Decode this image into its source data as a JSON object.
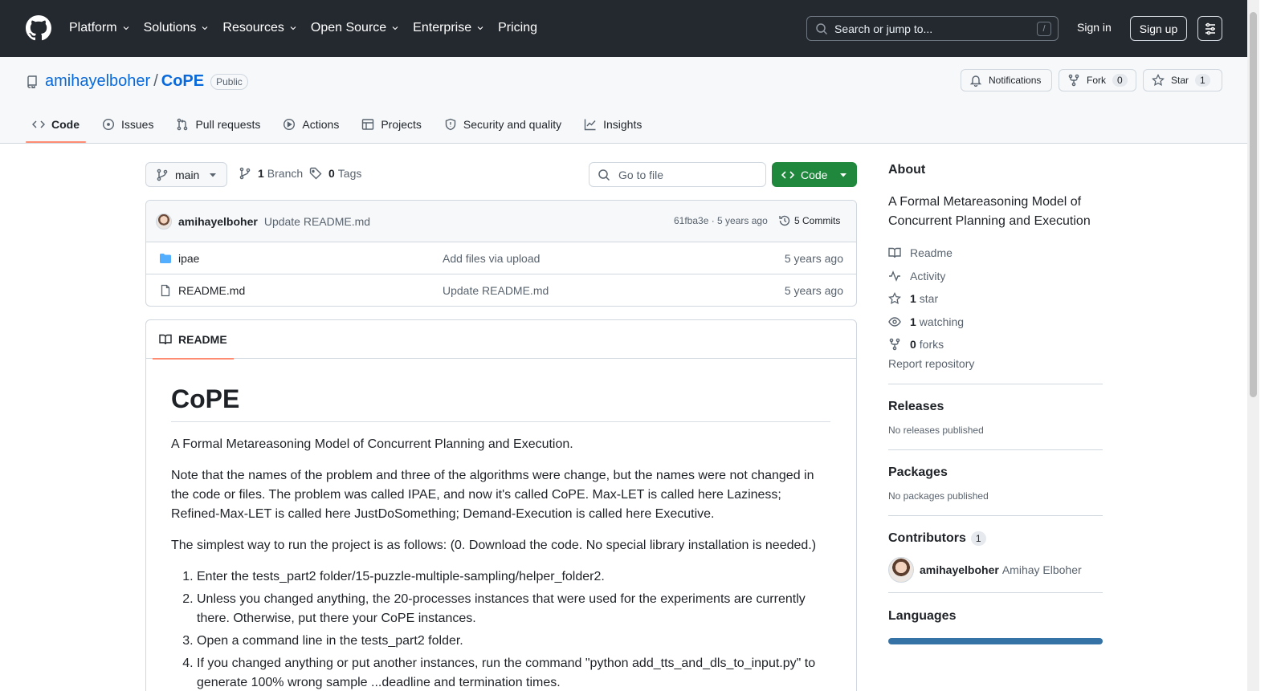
{
  "topbar": {
    "nav": [
      "Platform",
      "Solutions",
      "Resources",
      "Open Source",
      "Enterprise",
      "Pricing"
    ],
    "search_placeholder": "Search or jump to...",
    "search_shortcut": "/",
    "signin": "Sign in",
    "signup": "Sign up"
  },
  "repo": {
    "owner": "amihayelboher",
    "separator": "/",
    "name": "CoPE",
    "visibility": "Public",
    "notifications": "Notifications",
    "fork_label": "Fork",
    "fork_count": "0",
    "star_label": "Star",
    "star_count": "1",
    "tabs": [
      "Code",
      "Issues",
      "Pull requests",
      "Actions",
      "Projects",
      "Security and quality",
      "Insights"
    ]
  },
  "toolbar": {
    "branch": "main",
    "branch_count": "1",
    "branch_label": "Branch",
    "tag_count": "0",
    "tag_label": "Tags",
    "goto_placeholder": "Go to file",
    "code_button": "Code"
  },
  "commit": {
    "author": "amihayelboher",
    "message": "Update README.md",
    "hash_time": "61fba3e · 5 years ago",
    "commits": "5 Commits"
  },
  "files": [
    {
      "name": "ipae",
      "type": "folder",
      "message": "Add files via upload",
      "age": "5 years ago"
    },
    {
      "name": "README.md",
      "type": "file",
      "message": "Update README.md",
      "age": "5 years ago"
    }
  ],
  "readme": {
    "tab": "README",
    "title": "CoPE",
    "p1": "A Formal Metareasoning Model of Concurrent Planning and Execution.",
    "p2": "Note that the names of the problem and three of the algorithms were change, but the names were not changed in the code or files. The problem was called IPAE, and now it's called CoPE. Max-LET is called here Laziness; Refined-Max-LET is called here JustDoSomething; Demand-Execution is called here Executive.",
    "p3": "The simplest way to run the project is as follows: (0. Download the code. No special library installation is needed.)",
    "steps": [
      "Enter the tests_part2 folder/15-puzzle-multiple-sampling/helper_folder2.",
      "Unless you changed anything, the 20-processes instances that were used for the experiments are currently there. Otherwise, put there your CoPE instances.",
      "Open a command line in the tests_part2 folder.",
      "If you changed anything or put another instances, run the command \"python add_tts_and_dls_to_input.py\" to generate 100% wrong sample ...deadline and termination times."
    ]
  },
  "sidebar": {
    "about_title": "About",
    "about_desc": "A Formal Metareasoning Model of Concurrent Planning and Execution",
    "readme": "Readme",
    "activity": "Activity",
    "stars_count": "1",
    "stars_label": "star",
    "watching_count": "1",
    "watching_label": "watching",
    "forks_count": "0",
    "forks_label": "forks",
    "report": "Report repository",
    "releases_title": "Releases",
    "releases_text": "No releases published",
    "packages_title": "Packages",
    "packages_text": "No packages published",
    "contributors_title": "Contributors",
    "contributors_count": "1",
    "contributor_login": "amihayelboher",
    "contributor_name": "Amihay Elboher",
    "languages_title": "Languages",
    "language_color": "#3572a5"
  }
}
